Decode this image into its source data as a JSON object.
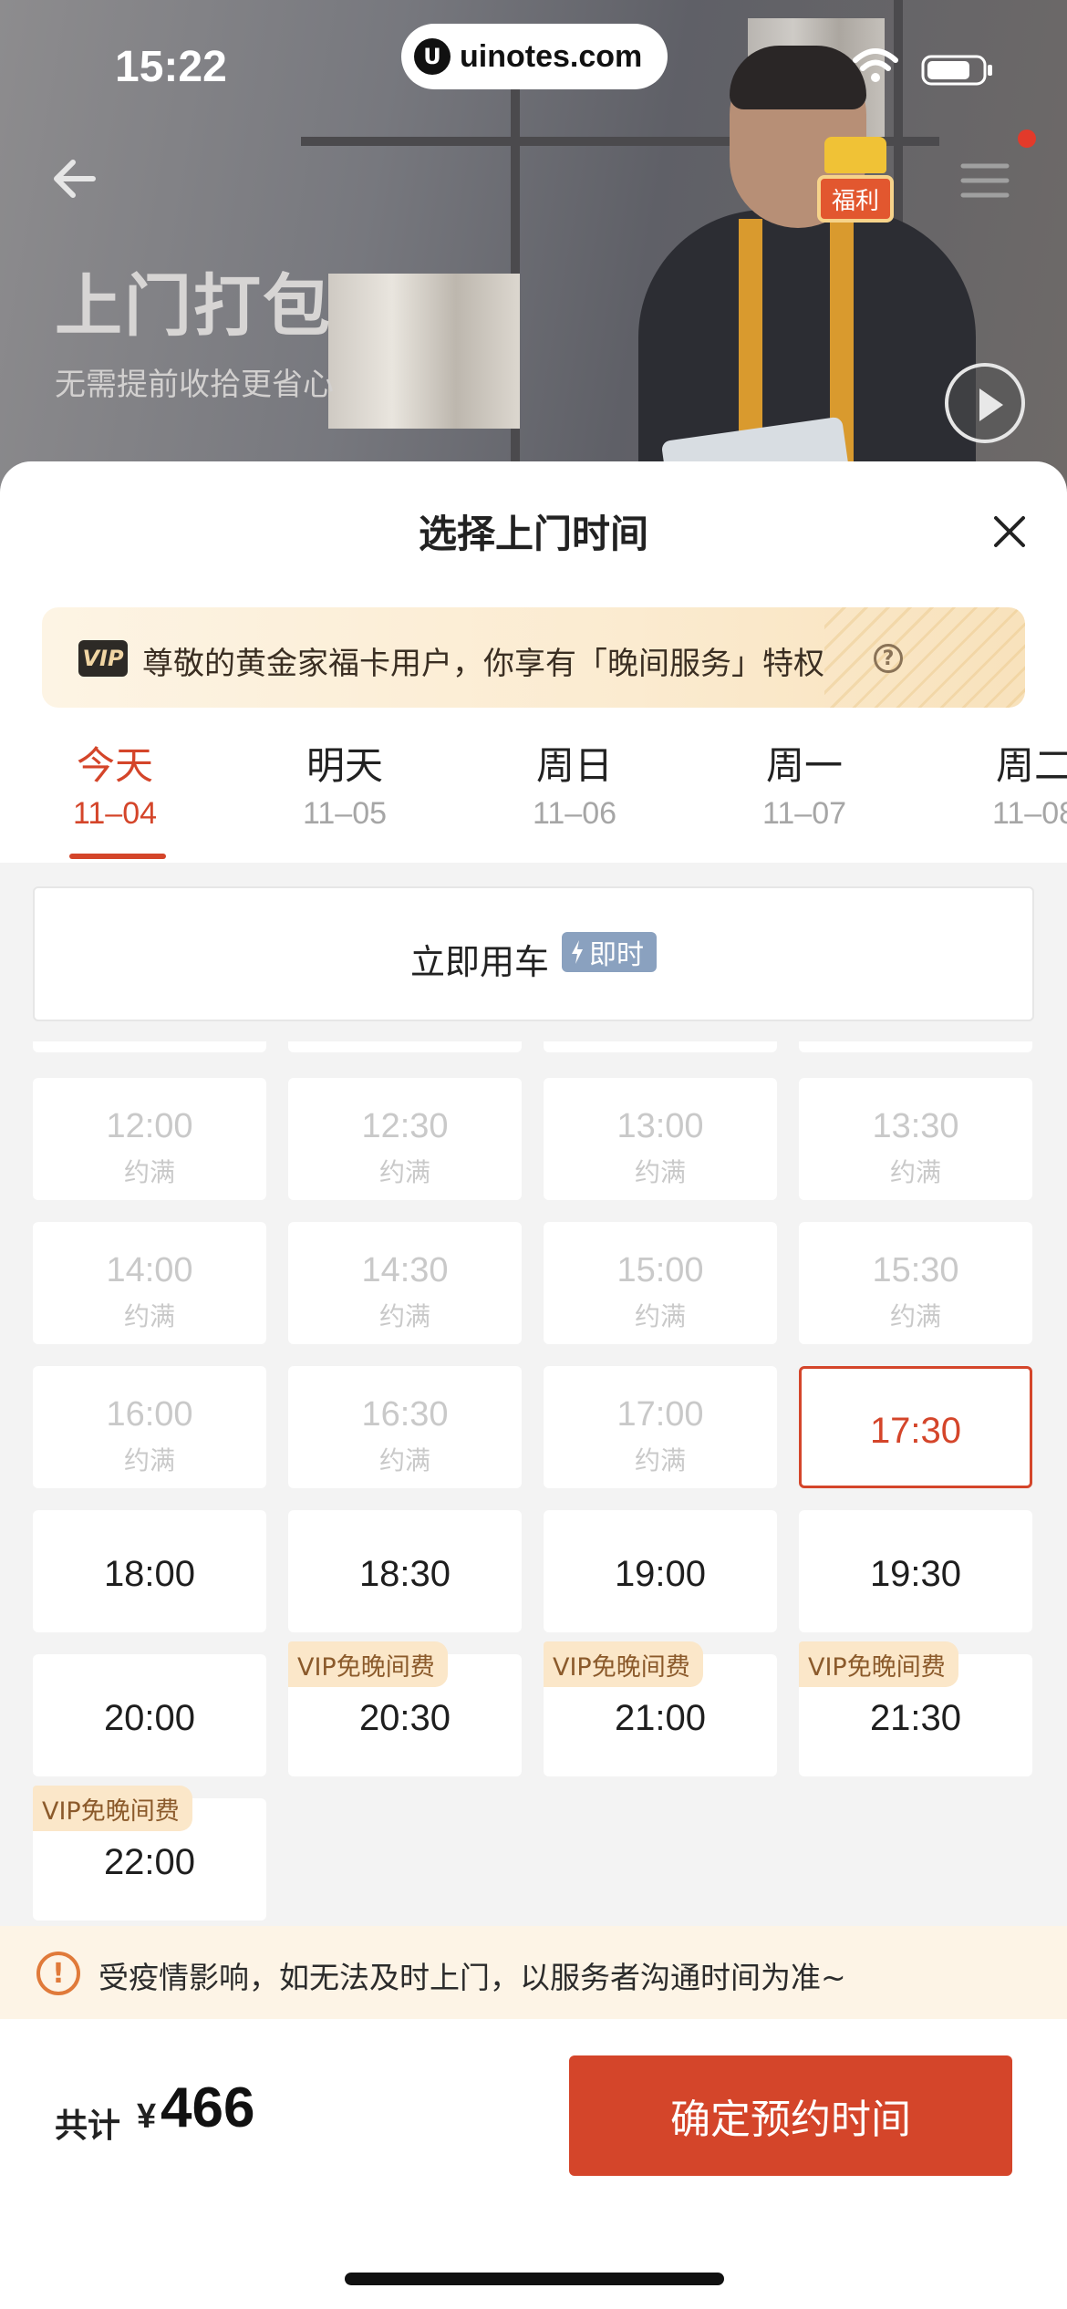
{
  "status_bar": {
    "time": "15:22",
    "url": "uinotes.com"
  },
  "hero": {
    "title": "上门打包",
    "subtitle": "无需提前收拾更省心",
    "gift_badge": "福利"
  },
  "sheet": {
    "title": "选择上门时间",
    "vip_banner": {
      "badge": "VIP",
      "text": "尊敬的黄金家福卡用户，你享有「晚间服务」特权",
      "help": "?"
    },
    "tabs": [
      {
        "day": "今天",
        "date": "11–04",
        "active": true
      },
      {
        "day": "明天",
        "date": "11–05"
      },
      {
        "day": "周日",
        "date": "11–06"
      },
      {
        "day": "周一",
        "date": "11–07"
      },
      {
        "day": "周二",
        "date": "11–08"
      }
    ],
    "instant": {
      "label": "立即用车",
      "tag": "即时"
    },
    "slots": [
      {
        "time": "12:00",
        "status": "约满"
      },
      {
        "time": "12:30",
        "status": "约满"
      },
      {
        "time": "13:00",
        "status": "约满"
      },
      {
        "time": "13:30",
        "status": "约满"
      },
      {
        "time": "14:00",
        "status": "约满"
      },
      {
        "time": "14:30",
        "status": "约满"
      },
      {
        "time": "15:00",
        "status": "约满"
      },
      {
        "time": "15:30",
        "status": "约满"
      },
      {
        "time": "16:00",
        "status": "约满"
      },
      {
        "time": "16:30",
        "status": "约满"
      },
      {
        "time": "17:00",
        "status": "约满"
      },
      {
        "time": "17:30",
        "selected": true
      },
      {
        "time": "18:00"
      },
      {
        "time": "18:30"
      },
      {
        "time": "19:00"
      },
      {
        "time": "19:30"
      },
      {
        "time": "20:00"
      },
      {
        "time": "20:30",
        "tag": "VIP免晚间费"
      },
      {
        "time": "21:00",
        "tag": "VIP免晚间费"
      },
      {
        "time": "21:30",
        "tag": "VIP免晚间费"
      },
      {
        "time": "22:00",
        "tag": "VIP免晚间费"
      }
    ],
    "notice": "受疫情影响，如无法及时上门，以服务者沟通时间为准~",
    "footer": {
      "total_label": "共计",
      "currency": "¥",
      "total_value": "466",
      "confirm_label": "确定预约时间"
    }
  },
  "colors": {
    "accent": "#d4452a",
    "vip_bg": "#fbe7c9",
    "instant_tag": "#8aa1bf"
  }
}
